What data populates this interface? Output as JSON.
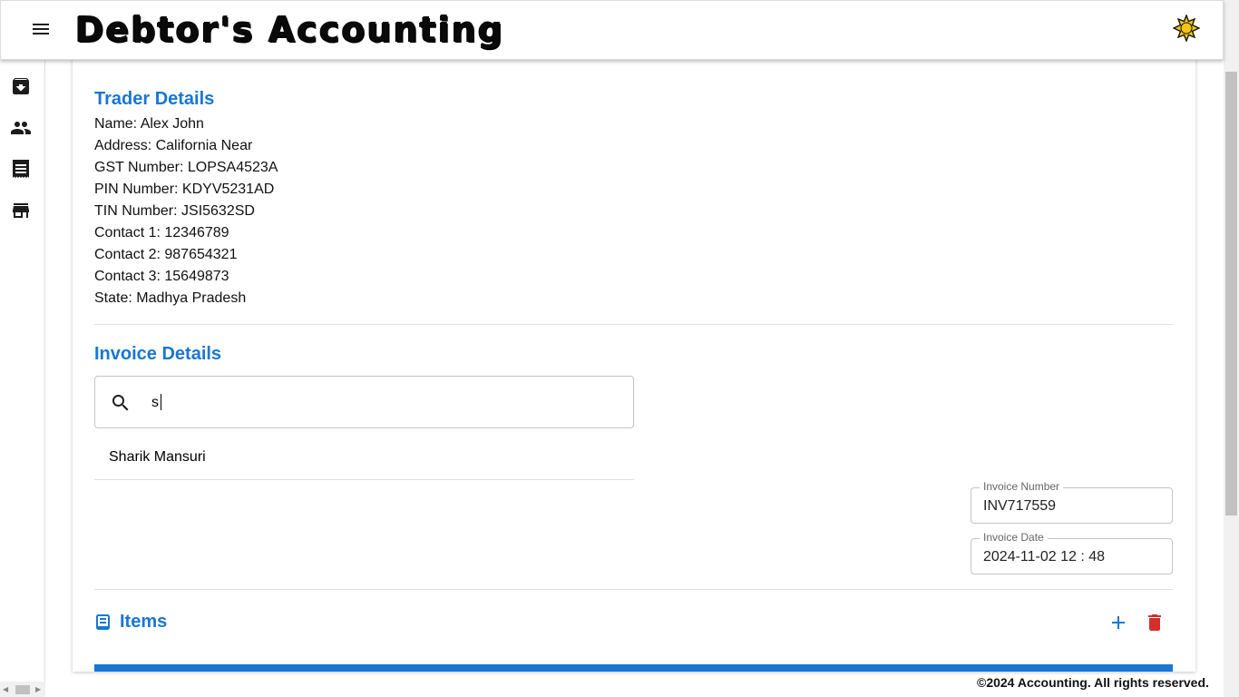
{
  "appbar": {
    "title": "Debtor's Accounting",
    "menu_icon": "menu-icon",
    "theme_icon": "sun-icon"
  },
  "sidebar": {
    "items": [
      {
        "icon": "archive-icon"
      },
      {
        "icon": "people-icon"
      },
      {
        "icon": "receipt-icon"
      },
      {
        "icon": "store-icon"
      }
    ]
  },
  "trader": {
    "heading": "Trader Details",
    "lines": [
      "Name: Alex John",
      "Address: California Near",
      "GST Number: LOPSA4523A",
      "PIN Number: KDYV5231AD",
      "TIN Number: JSI5632SD",
      "Contact 1: 12346789",
      "Contact 2: 987654321",
      "Contact 3: 15649873",
      "State: Madhya Pradesh"
    ]
  },
  "invoice": {
    "heading": "Invoice Details",
    "search_value": "s",
    "suggestion": "Sharik Mansuri",
    "number_label": "Invoice Number",
    "number_value": "INV717559",
    "date_label": "Invoice Date",
    "date_value": "2024-11-02 12 : 48"
  },
  "items": {
    "heading": "Items"
  },
  "colors": {
    "accent": "#1976d2",
    "danger": "#d32f2f",
    "sun": "#f5c518"
  },
  "footer": {
    "text": "©2024 Accounting. All rights reserved."
  }
}
